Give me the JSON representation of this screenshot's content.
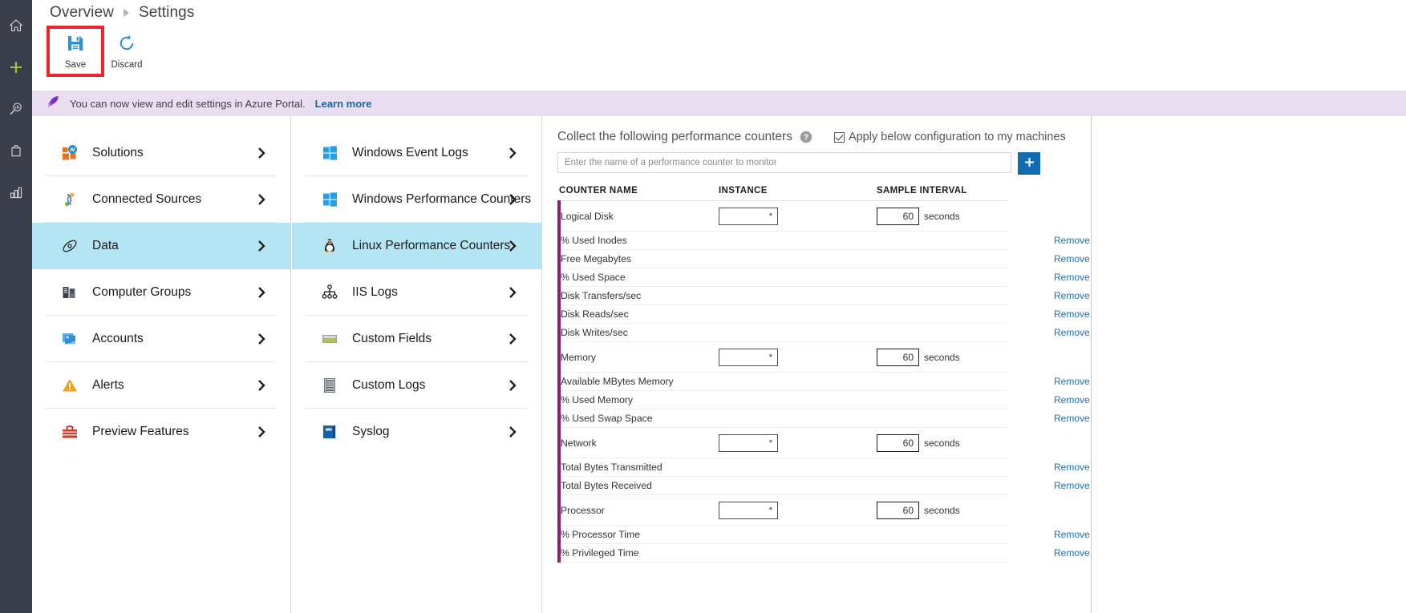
{
  "rail": {
    "items": [
      {
        "name": "home-icon",
        "label": "Home"
      },
      {
        "name": "add-icon",
        "label": "New"
      },
      {
        "name": "search-icon",
        "label": "Log Search"
      },
      {
        "name": "briefcase-icon",
        "label": "My Dashboard"
      },
      {
        "name": "bar-chart-icon",
        "label": "Usage"
      }
    ]
  },
  "breadcrumb": {
    "root": "Overview",
    "current": "Settings"
  },
  "toolbar": {
    "save_label": "Save",
    "discard_label": "Discard",
    "highlight_color": "#e8262d"
  },
  "notice": {
    "icon": "rocket-icon",
    "text": "You can now view and edit settings in Azure Portal.",
    "link": "Learn more"
  },
  "column1": {
    "items": [
      {
        "label": "Solutions",
        "icon": "solutions-icon",
        "selected": false
      },
      {
        "label": "Connected Sources",
        "icon": "connected-sources-icon",
        "selected": false
      },
      {
        "label": "Data",
        "icon": "data-icon",
        "selected": true
      },
      {
        "label": "Computer Groups",
        "icon": "computer-groups-icon",
        "selected": false
      },
      {
        "label": "Accounts",
        "icon": "accounts-icon",
        "selected": false
      },
      {
        "label": "Alerts",
        "icon": "alerts-icon",
        "selected": false
      },
      {
        "label": "Preview Features",
        "icon": "preview-features-icon",
        "selected": false
      }
    ]
  },
  "column2": {
    "items": [
      {
        "label": "Windows Event Logs",
        "icon": "windows-icon",
        "selected": false
      },
      {
        "label": "Windows Performance Counters",
        "icon": "windows-icon",
        "selected": false
      },
      {
        "label": "Linux Performance Counters",
        "icon": "linux-penguin-icon",
        "selected": true
      },
      {
        "label": "IIS Logs",
        "icon": "iis-sitemap-icon",
        "selected": false
      },
      {
        "label": "Custom Fields",
        "icon": "custom-fields-icon",
        "selected": false
      },
      {
        "label": "Custom Logs",
        "icon": "custom-logs-icon",
        "selected": false
      },
      {
        "label": "Syslog",
        "icon": "syslog-book-icon",
        "selected": false
      }
    ]
  },
  "main": {
    "title": "Collect the following performance counters",
    "help_icon": "help-icon",
    "apply_checkbox": {
      "label": "Apply below configuration to my machines",
      "checked": true
    },
    "add_placeholder": "Enter the name of a performance counter to monitor",
    "add_value": "",
    "add_button_icon": "plus-icon",
    "columns": [
      "COUNTER NAME",
      "INSTANCE",
      "SAMPLE INTERVAL"
    ],
    "remove_label": "Remove",
    "seconds_label": "seconds",
    "accent_color": "#8b1d7a",
    "rows": [
      {
        "type": "group",
        "name": "Logical Disk",
        "instance": "*",
        "interval": "60"
      },
      {
        "type": "sub",
        "name": "% Used Inodes"
      },
      {
        "type": "sub",
        "name": "Free Megabytes"
      },
      {
        "type": "sub",
        "name": "% Used Space"
      },
      {
        "type": "sub",
        "name": "Disk Transfers/sec"
      },
      {
        "type": "sub",
        "name": "Disk Reads/sec"
      },
      {
        "type": "sub",
        "name": "Disk Writes/sec"
      },
      {
        "type": "group",
        "name": "Memory",
        "instance": "*",
        "interval": "60"
      },
      {
        "type": "sub",
        "name": "Available MBytes Memory"
      },
      {
        "type": "sub",
        "name": "% Used Memory"
      },
      {
        "type": "sub",
        "name": "% Used Swap Space"
      },
      {
        "type": "group",
        "name": "Network",
        "instance": "*",
        "interval": "60"
      },
      {
        "type": "sub",
        "name": "Total Bytes Transmitted"
      },
      {
        "type": "sub",
        "name": "Total Bytes Received"
      },
      {
        "type": "group",
        "name": "Processor",
        "instance": "*",
        "interval": "60"
      },
      {
        "type": "sub",
        "name": "% Processor Time"
      },
      {
        "type": "sub",
        "name": "% Privileged Time"
      }
    ]
  }
}
